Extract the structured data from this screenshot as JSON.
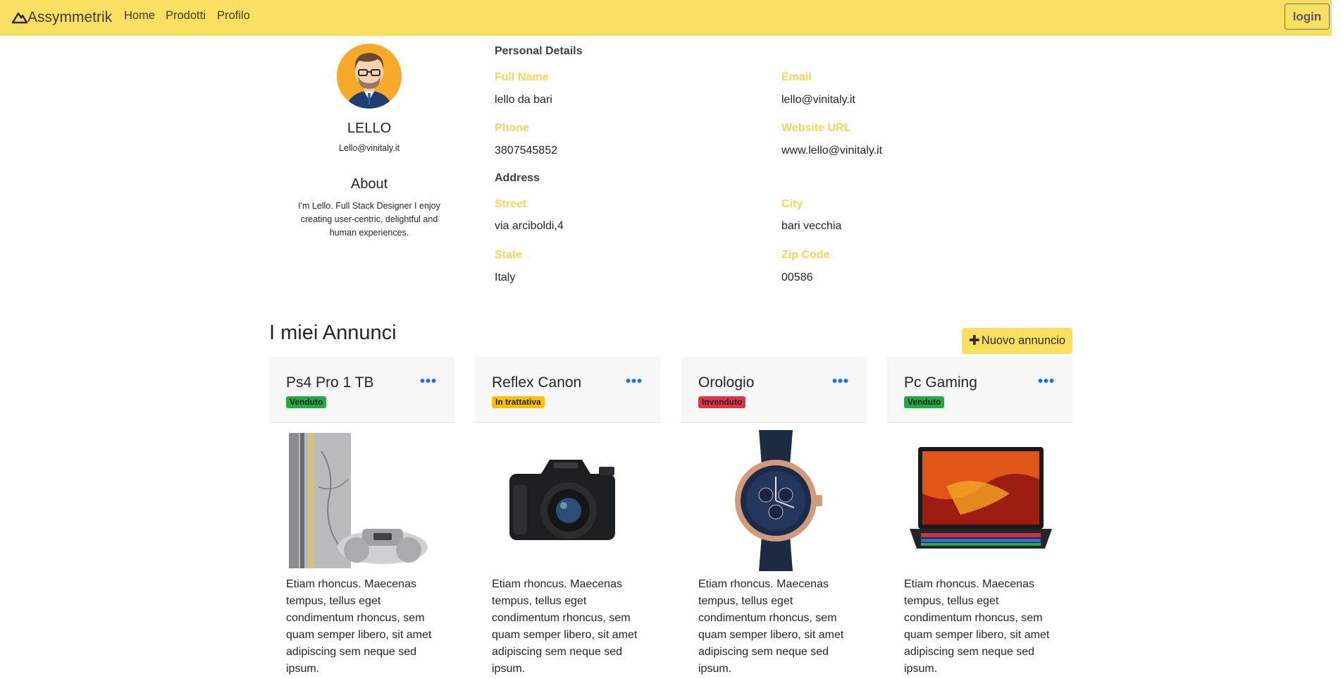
{
  "navbar": {
    "brand": "Assymmetrik",
    "links": [
      "Home",
      "Prodotti",
      "Profilo"
    ],
    "login_label": "login"
  },
  "profile": {
    "name": "LELLO",
    "email": "Lello@vinitaly.it",
    "about_title": "About",
    "about_text": "I'm Lello. Full Stack Designer I enjoy creating user-centric, delightful and human experiences."
  },
  "details": {
    "personal_title": "Personal Details",
    "full_name_label": "Full Name",
    "full_name": "lello da bari",
    "email_label": "Email",
    "email": "lello@vinitaly.it",
    "phone_label": "Phone",
    "phone": "3807545852",
    "website_label": "Website URL",
    "website": "www.lello@vinitaly.it",
    "address_title": "Address",
    "street_label": "Street",
    "street": "via arciboldi,4",
    "city_label": "City",
    "city": "bari vecchia",
    "state_label": "State",
    "state": "Italy",
    "zip_label": "Zip Code",
    "zip": "00586"
  },
  "annunci": {
    "title": "I miei Annunci",
    "new_button": "Nuovo annuncio",
    "cards": [
      {
        "title": "Ps4 Pro 1 TB",
        "status": "Venduto",
        "status_color": "#28a745",
        "text": "Etiam rhoncus. Maecenas tempus, tellus eget condimentum rhoncus, sem quam semper libero, sit amet adipiscing sem neque sed ipsum.",
        "image": "ps4-console-image"
      },
      {
        "title": "Reflex Canon",
        "status": "In trattativa",
        "status_color": "#ffc107",
        "text": "Etiam rhoncus. Maecenas tempus, tellus eget condimentum rhoncus, sem quam semper libero, sit amet adipiscing sem neque sed ipsum.",
        "image": "camera-image"
      },
      {
        "title": "Orologio",
        "status": "Invenduto",
        "status_color": "#dc3545",
        "text": "Etiam rhoncus. Maecenas tempus, tellus eget condimentum rhoncus, sem quam semper libero, sit amet adipiscing sem neque sed ipsum.",
        "image": "watch-image"
      },
      {
        "title": "Pc Gaming",
        "status": "Venduto",
        "status_color": "#28a745",
        "text": "Etiam rhoncus. Maecenas tempus, tellus eget condimentum rhoncus, sem quam semper libero, sit amet adipiscing sem neque sed ipsum.",
        "image": "laptop-image"
      }
    ]
  },
  "colors": {
    "navbar": "#fbdf61",
    "label_accent": "#f6d35e",
    "link_blue": "#0d6efd"
  }
}
